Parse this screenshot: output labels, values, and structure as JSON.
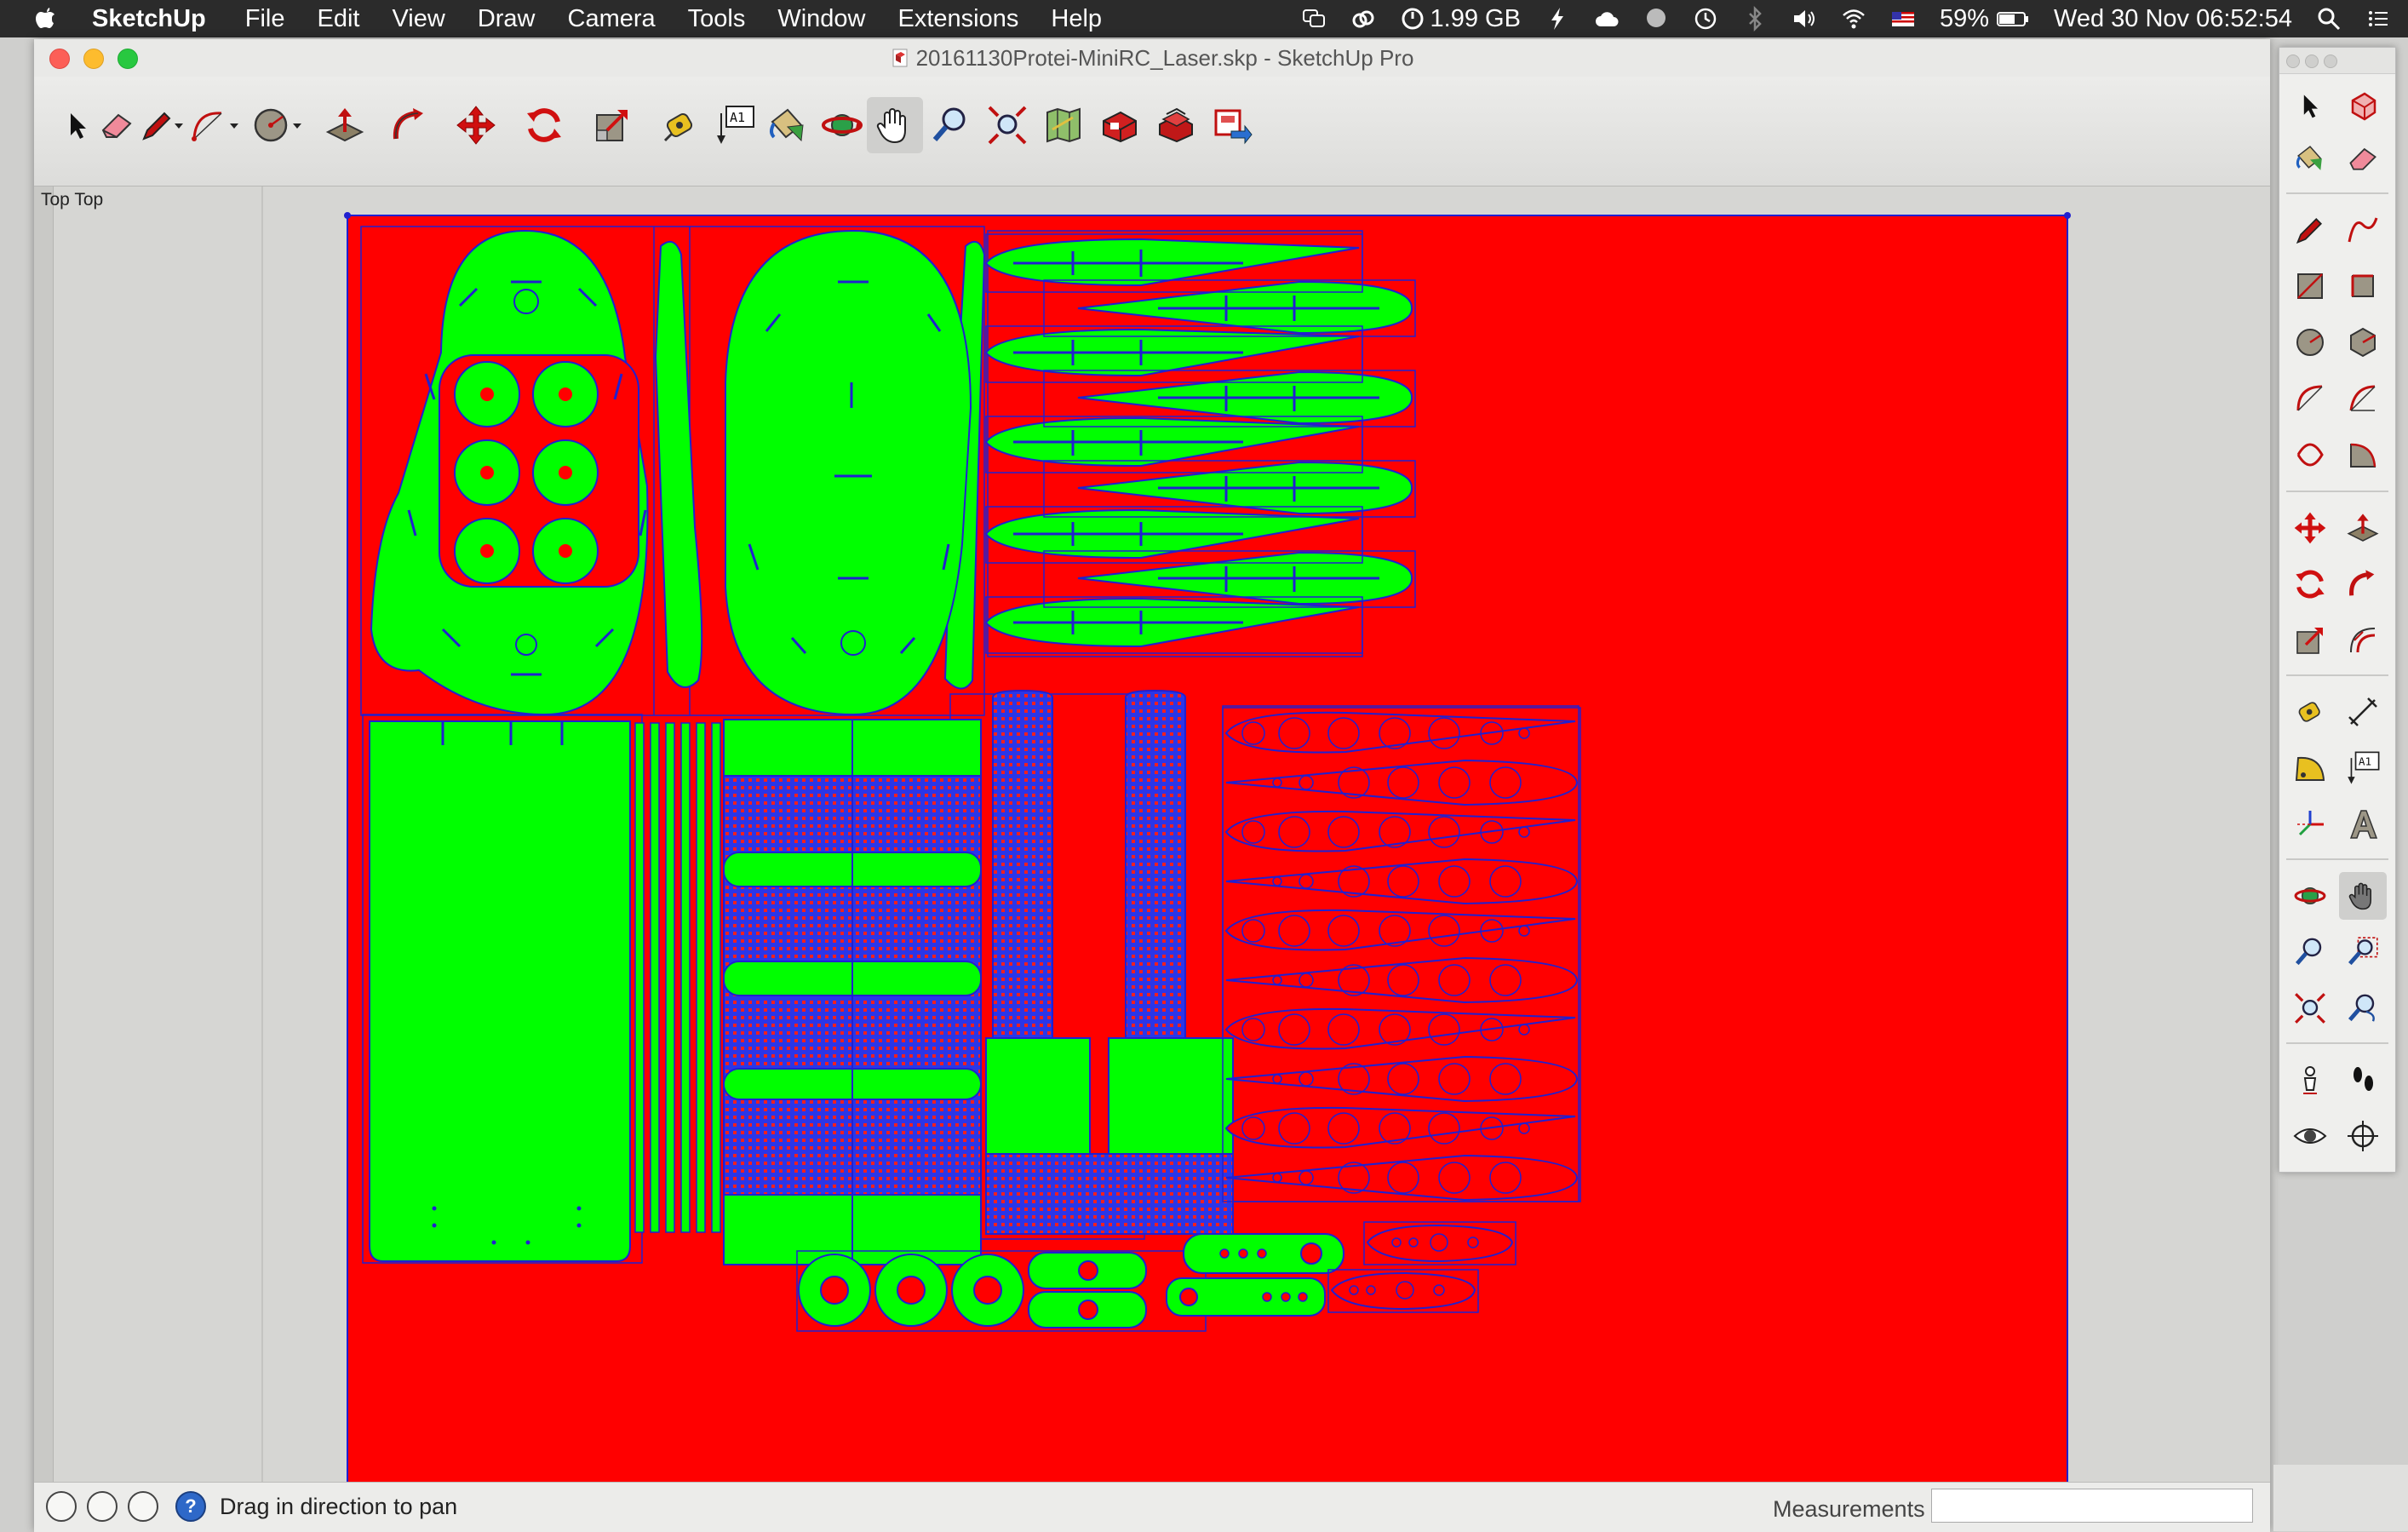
{
  "menubar": {
    "app_name": "SketchUp",
    "menus": [
      "File",
      "Edit",
      "View",
      "Draw",
      "Camera",
      "Tools",
      "Window",
      "Extensions",
      "Help"
    ],
    "memory": "1.99 GB",
    "battery": "59%",
    "datetime": "Wed 30 Nov  06:52:54"
  },
  "window": {
    "title": "20161130Protei-MiniRC_Laser.skp - SketchUp Pro",
    "scene_label": "Top"
  },
  "toolbar": {
    "tools": [
      "select-icon",
      "eraser-icon",
      "pencil-icon",
      "arc-icon",
      "circle-icon",
      "push-pull-icon",
      "follow-me-icon",
      "move-icon",
      "rotate-icon",
      "scale-icon",
      "tape-measure-icon",
      "text-icon",
      "paint-bucket-icon",
      "orbit-icon",
      "pan-icon",
      "zoom-icon",
      "zoom-extents-icon",
      "add-location-icon",
      "warehouse-icon",
      "extension-warehouse-icon",
      "send-to-layout-icon"
    ],
    "active_tool": "pan-icon",
    "text_tool_label": "A1"
  },
  "palette": {
    "active_tool": "pan-icon",
    "text_tool_label": "A1"
  },
  "statusbar": {
    "message": "Drag in direction to pan",
    "measurements_label": "Measurements",
    "measurements_value": ""
  },
  "colors": {
    "sheet": "#ff0000",
    "parts": "#00ff00",
    "edges": "#2020d0"
  }
}
